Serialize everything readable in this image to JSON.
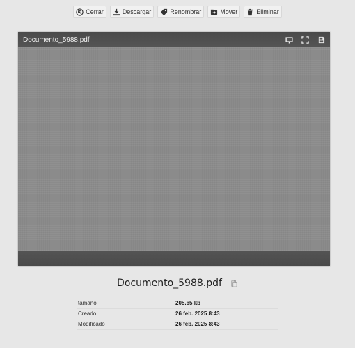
{
  "toolbar": {
    "close": {
      "label": "Cerrar",
      "icon": "back-arrow-circle-icon"
    },
    "download": {
      "label": "Descargar",
      "icon": "download-icon"
    },
    "rename": {
      "label": "Renombrar",
      "icon": "tag-icon"
    },
    "move": {
      "label": "Mover",
      "icon": "folder-move-icon"
    },
    "delete": {
      "label": "Eliminar",
      "icon": "trash-icon"
    }
  },
  "viewer": {
    "title": "Documento_5988.pdf",
    "actions": [
      "presentation-icon",
      "fullscreen-icon",
      "save-icon"
    ]
  },
  "file": {
    "name": "Documento_5988.pdf",
    "copy_icon": "copy-icon"
  },
  "meta": [
    {
      "label": "tamaño",
      "value": "205.65 kb"
    },
    {
      "label": "Creado",
      "value": "26 feb. 2025 8:43"
    },
    {
      "label": "Modificado",
      "value": "26 feb. 2025 8:43"
    }
  ],
  "colors": {
    "background": "#e7e7e7",
    "viewer_bar": "#4f4f4f",
    "viewer_canvas": "#8b8b8b"
  }
}
